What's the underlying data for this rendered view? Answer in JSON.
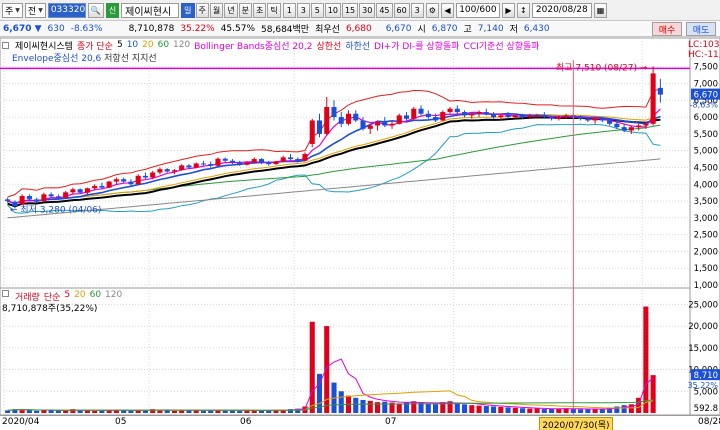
{
  "toolbar": {
    "market": "주",
    "market_mode": "전",
    "code": "033320",
    "credit_badge": "신",
    "stock_name": "제이씨현시",
    "period_buttons": [
      "일",
      "주",
      "월",
      "년",
      "분",
      "초",
      "틱"
    ],
    "minute_buttons": [
      "1",
      "3",
      "5",
      "10",
      "15",
      "30",
      "45",
      "60",
      "3"
    ],
    "counter": "100/600",
    "date": "2020/08/28"
  },
  "quote": {
    "price": "6,670 ▼",
    "change": "630",
    "change_pct": "-8.63%",
    "volume": "8,710,878",
    "vol_ratio": "35.22%",
    "turnover": "45.57%",
    "amount": "58,684백만",
    "best_ask_label": "최우선",
    "best_ask": "6,680",
    "best_bid": "6,670",
    "open_label": "시",
    "open": "6,870",
    "high_label": "고",
    "high": "7,140",
    "low_label": "저",
    "low": "6,430",
    "buy_label": "매수",
    "sell_label": "매도"
  },
  "price_legend": {
    "name": "제이씨현시스템",
    "ma_label": "종가 단순",
    "ma_periods": [
      "5",
      "10",
      "20",
      "60",
      "120"
    ],
    "ma_colors": [
      "#000000",
      "#1b4fd8",
      "#e0a000",
      "#2a9a3a",
      "#888888"
    ],
    "bb": "Bollinger Bands중심선 20,2",
    "bb_upper": "상한선",
    "bb_lower": "하한선",
    "dmi": "DI+가 DI-를 상향돌파",
    "cci": "CCI기준선 상향돌파",
    "envelope": "Envelope중심선 20,6",
    "env_upper": "저항선",
    "env_lower": "지지선",
    "lc_label": "LC:103,",
    "hc_label": "HC:-11,",
    "max_label": "최고 7,510 (08/27)",
    "min_label": "최저 3,280 (04/06)"
  },
  "volume_legend": {
    "name": "거래량",
    "ma_label": "단순",
    "ma_periods": [
      "5",
      "20",
      "60",
      "120"
    ],
    "current": "8,710,878주(35,22%)"
  },
  "right_axis": {
    "price_ticks": [
      "7,500",
      "7,000",
      "6,500",
      "6,000",
      "5,500",
      "5,000",
      "4,500",
      "4,000",
      "3,500",
      "3,000",
      "2,500",
      "2,000",
      "1,500",
      "1,000"
    ],
    "current_price": "6,670",
    "current_pct": "-8,63%",
    "volume_ticks": [
      "25,000",
      "20,000",
      "15,000",
      "10,000",
      "5,000"
    ],
    "vol_current": "8,710",
    "vol_pct": "35,22%",
    "vol_bottom": "592.8"
  },
  "x_axis": {
    "labels": [
      "2020/04",
      "05",
      "06",
      "07",
      "08/28"
    ],
    "cursor_label": "2020/07/30(목)"
  },
  "colors": {
    "up": "#e0001a",
    "down": "#1b4fd8",
    "bb": "#e02020",
    "env": "#e000e0"
  },
  "chart_data": {
    "type": "candlestick",
    "y_range": [
      1000,
      7700
    ],
    "candles": [
      [
        3550,
        3600,
        3450,
        3500
      ],
      [
        3480,
        3520,
        3280,
        3350
      ],
      [
        3400,
        3700,
        3380,
        3650
      ],
      [
        3650,
        3700,
        3500,
        3550
      ],
      [
        3550,
        3600,
        3450,
        3480
      ],
      [
        3500,
        3750,
        3480,
        3700
      ],
      [
        3700,
        3760,
        3600,
        3640
      ],
      [
        3640,
        3700,
        3550,
        3600
      ],
      [
        3600,
        3800,
        3580,
        3760
      ],
      [
        3760,
        3900,
        3700,
        3850
      ],
      [
        3850,
        3880,
        3720,
        3750
      ],
      [
        3750,
        3900,
        3700,
        3880
      ],
      [
        3880,
        4000,
        3820,
        3950
      ],
      [
        3950,
        4050,
        3850,
        3900
      ],
      [
        3900,
        4100,
        3880,
        4080
      ],
      [
        4080,
        4200,
        4000,
        4150
      ],
      [
        4150,
        4200,
        4050,
        4080
      ],
      [
        4080,
        4150,
        3950,
        4000
      ],
      [
        4000,
        4300,
        3980,
        4250
      ],
      [
        4250,
        4350,
        4150,
        4200
      ],
      [
        4200,
        4400,
        4150,
        4350
      ],
      [
        4350,
        4500,
        4300,
        4450
      ],
      [
        4450,
        4480,
        4350,
        4380
      ],
      [
        4380,
        4450,
        4300,
        4420
      ],
      [
        4420,
        4600,
        4400,
        4560
      ],
      [
        4560,
        4600,
        4450,
        4500
      ],
      [
        4500,
        4650,
        4480,
        4620
      ],
      [
        4620,
        4700,
        4550,
        4600
      ],
      [
        4600,
        4680,
        4500,
        4550
      ],
      [
        4550,
        4800,
        4520,
        4760
      ],
      [
        4760,
        4800,
        4650,
        4700
      ],
      [
        4700,
        4750,
        4600,
        4650
      ],
      [
        4650,
        4700,
        4550,
        4580
      ],
      [
        4580,
        4680,
        4560,
        4650
      ],
      [
        4650,
        4800,
        4620,
        4750
      ],
      [
        4750,
        4780,
        4600,
        4650
      ],
      [
        4650,
        4700,
        4550,
        4600
      ],
      [
        4600,
        4700,
        4580,
        4680
      ],
      [
        4680,
        4850,
        4650,
        4800
      ],
      [
        4800,
        4900,
        4700,
        4750
      ],
      [
        4750,
        4800,
        4650,
        4700
      ],
      [
        4700,
        4950,
        4680,
        4900
      ],
      [
        5200,
        5950,
        5100,
        5900
      ],
      [
        5900,
        6100,
        5400,
        5500
      ],
      [
        5500,
        6600,
        5450,
        6300
      ],
      [
        6300,
        6500,
        5900,
        6000
      ],
      [
        6000,
        6150,
        5700,
        5800
      ],
      [
        5800,
        6200,
        5750,
        6100
      ],
      [
        6100,
        6200,
        5850,
        5900
      ],
      [
        5900,
        6000,
        5600,
        5650
      ],
      [
        5650,
        5800,
        5500,
        5750
      ],
      [
        5750,
        5900,
        5600,
        5850
      ],
      [
        5850,
        6000,
        5700,
        5750
      ],
      [
        5750,
        5900,
        5650,
        5800
      ],
      [
        5800,
        6100,
        5780,
        6050
      ],
      [
        6050,
        6150,
        5900,
        5950
      ],
      [
        5950,
        6300,
        5900,
        6250
      ],
      [
        6250,
        6350,
        6050,
        6100
      ],
      [
        6100,
        6200,
        5950,
        6000
      ],
      [
        6000,
        6100,
        5850,
        5900
      ],
      [
        5900,
        6200,
        5880,
        6150
      ],
      [
        6150,
        6300,
        6100,
        6250
      ],
      [
        6250,
        6350,
        6100,
        6150
      ],
      [
        6150,
        6200,
        6000,
        6050
      ],
      [
        6050,
        6150,
        5950,
        6100
      ],
      [
        6100,
        6200,
        6000,
        6150
      ],
      [
        6150,
        6250,
        6050,
        6100
      ],
      [
        6100,
        6150,
        5950,
        6000
      ],
      [
        6000,
        6100,
        5900,
        6050
      ],
      [
        6050,
        6150,
        5950,
        6000
      ],
      [
        6000,
        6100,
        5950,
        6050
      ],
      [
        6050,
        6100,
        5950,
        6000
      ],
      [
        6000,
        6100,
        5950,
        6050
      ],
      [
        6050,
        6100,
        6000,
        6050
      ],
      [
        6050,
        6150,
        5950,
        6000
      ],
      [
        6000,
        6050,
        5900,
        5950
      ],
      [
        5950,
        6050,
        5900,
        6000
      ],
      [
        6000,
        6100,
        5950,
        6050
      ],
      [
        6050,
        6100,
        5950,
        6000
      ],
      [
        6000,
        6050,
        5900,
        5950
      ],
      [
        5950,
        6000,
        5850,
        5900
      ],
      [
        5900,
        6000,
        5800,
        5950
      ],
      [
        5950,
        6000,
        5850,
        5900
      ],
      [
        5900,
        5950,
        5750,
        5800
      ],
      [
        5800,
        5900,
        5650,
        5700
      ],
      [
        5700,
        5800,
        5550,
        5600
      ],
      [
        5600,
        5750,
        5500,
        5700
      ],
      [
        5700,
        5800,
        5600,
        5750
      ],
      [
        5750,
        5850,
        5650,
        5800
      ],
      [
        5800,
        7510,
        5750,
        7300
      ],
      [
        6870,
        7140,
        6430,
        6670
      ]
    ],
    "volumes": [
      600,
      900,
      700,
      800,
      500,
      600,
      700,
      550,
      500,
      900,
      700,
      600,
      500,
      600,
      800,
      700,
      600,
      500,
      700,
      600,
      900,
      800,
      600,
      500,
      700,
      800,
      600,
      500,
      600,
      700,
      800,
      600,
      500,
      700,
      600,
      500,
      600,
      700,
      800,
      900,
      1000,
      1500,
      21000,
      9000,
      20000,
      7000,
      5000,
      4000,
      3500,
      3000,
      2800,
      2500,
      2600,
      2400,
      2200,
      2500,
      2700,
      2300,
      2100,
      2000,
      2500,
      2700,
      2200,
      2000,
      1800,
      1700,
      1600,
      1500,
      1400,
      1300,
      1200,
      1100,
      1000,
      1050,
      900,
      950,
      1000,
      1100,
      900,
      850,
      800,
      900,
      1000,
      1200,
      1500,
      1800,
      2000,
      3500,
      24500,
      8710
    ],
    "volume_y_range": [
      0,
      26000
    ]
  }
}
